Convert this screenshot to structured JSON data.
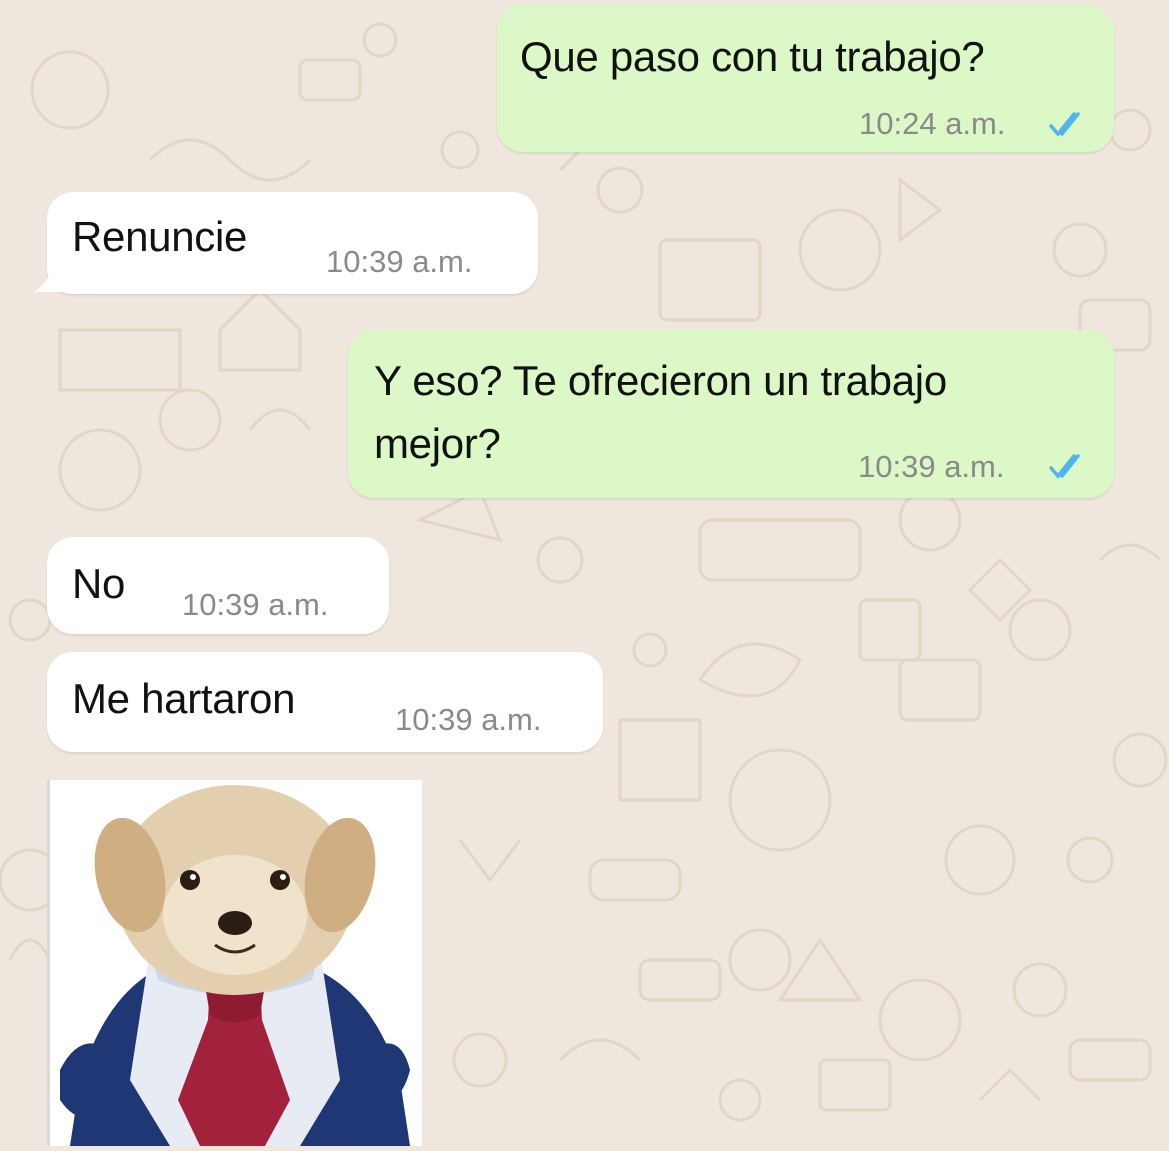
{
  "chat": {
    "messages": [
      {
        "direction": "outgoing",
        "text": "Que paso con tu trabajo?",
        "time": "10:24 a.m.",
        "status_icon": "double-check-read-icon"
      },
      {
        "direction": "incoming",
        "text": "Renuncie",
        "time": "10:39 a.m."
      },
      {
        "direction": "outgoing",
        "text_line1": "Y eso? Te ofrecieron un trabajo",
        "text_line2": "mejor?",
        "time": "10:39 a.m.",
        "status_icon": "double-check-read-icon"
      },
      {
        "direction": "incoming",
        "text": "No",
        "time": "10:39 a.m."
      },
      {
        "direction": "incoming",
        "text": "Me hartaron",
        "time": "10:39 a.m."
      }
    ],
    "sticker": {
      "icon": "puppy-in-suit-sticker"
    },
    "colors": {
      "outgoing_bubble": "#dcf8c6",
      "incoming_bubble": "#ffffff",
      "wallpaper": "#efe7dd",
      "read_ticks": "#4fb6ec"
    }
  }
}
